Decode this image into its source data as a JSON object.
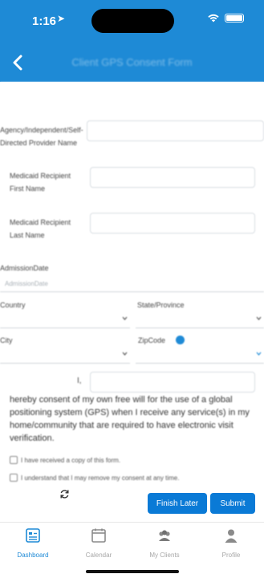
{
  "status": {
    "time": "1:16",
    "location_arrow": "➤"
  },
  "header": {
    "title": "Client GPS Consent Form",
    "back_icon": "chevron-left-icon",
    "color": "#1e8ad6"
  },
  "form": {
    "agency_label": "Agency/Independent/Self-Directed Provider Name",
    "medicaid_first_label": "Medicaid Recipient First Name",
    "medicaid_last_label": "Medicaid Recipient Last Name",
    "admission_label": "AdmissionDate",
    "admission_placeholder": "AdmissionDate",
    "country_label": "Country",
    "state_label": "State/Province",
    "city_label": "City",
    "zip_label": "ZipCode",
    "i_label": "I,",
    "consent_text": "hereby consent of my own free will for the use of a global positioning system (GPS) when I receive any service(s) in my home/community that are required to have electronic visit verification.",
    "checkbox_copy": "I have received a copy of this form.",
    "checkbox_remove": "I understand that I may remove my consent at any time."
  },
  "actions": {
    "finish_later": "Finish Later",
    "submit": "Submit"
  },
  "tabs": [
    {
      "label": "Dashboard",
      "icon": "dashboard-icon"
    },
    {
      "label": "Calendar",
      "icon": "calendar-icon"
    },
    {
      "label": "My Clients",
      "icon": "clients-icon"
    },
    {
      "label": "Profile",
      "icon": "profile-icon"
    }
  ]
}
